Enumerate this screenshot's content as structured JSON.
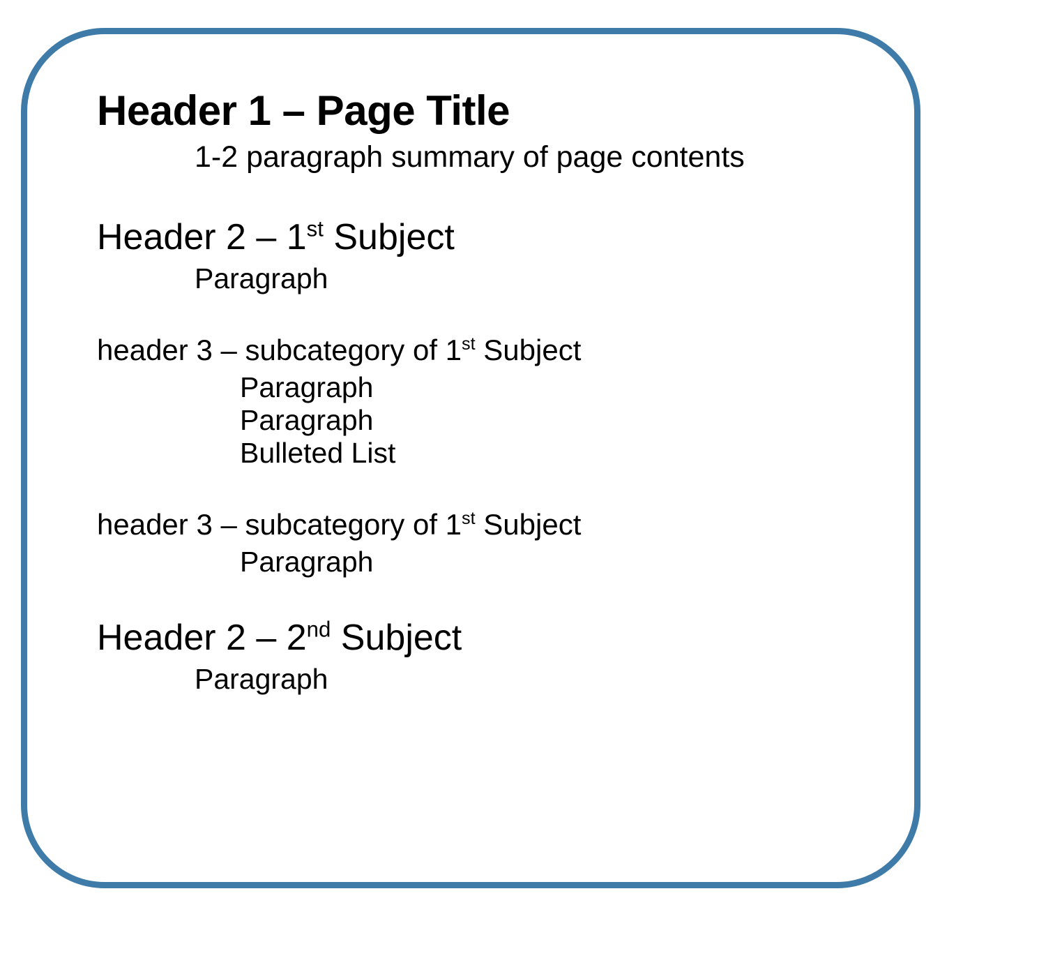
{
  "h1": "Header 1 – Page Title",
  "summary": "1-2 paragraph summary of page contents",
  "section1": {
    "h2_pre": "Header 2 – 1",
    "h2_sup": "st",
    "h2_post": " Subject",
    "body1": "Paragraph",
    "sub1": {
      "h3_pre": "header 3 – subcategory of 1",
      "h3_sup": "st",
      "h3_post": " Subject",
      "line1": "Paragraph",
      "line2": "Paragraph",
      "line3": "Bulleted List"
    },
    "sub2": {
      "h3_pre": "header 3 – subcategory of 1",
      "h3_sup": "st",
      "h3_post": " Subject",
      "line1": "Paragraph"
    }
  },
  "section2": {
    "h2_pre": "Header 2 – 2",
    "h2_sup": "nd",
    "h2_post": " Subject",
    "body1": "Paragraph"
  }
}
